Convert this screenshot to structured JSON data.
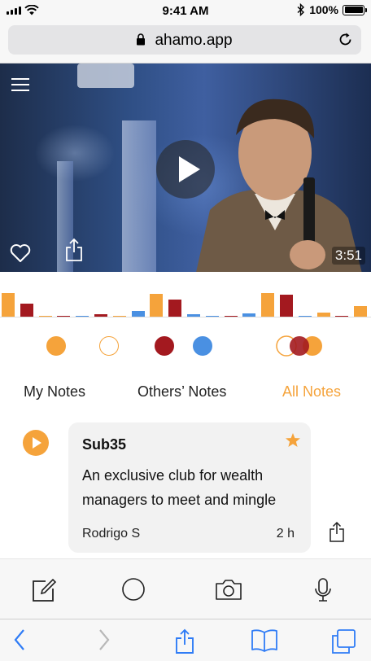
{
  "status_bar": {
    "time": "9:41 AM",
    "battery_percent": "100%",
    "icons": [
      "signal-icon",
      "wifi-icon",
      "bluetooth-icon",
      "battery-icon"
    ]
  },
  "browser": {
    "url": "ahamo.app",
    "icons": [
      "lock-icon",
      "reload-icon"
    ]
  },
  "video": {
    "duration": "3:51",
    "icons": [
      "menu-icon",
      "play-icon",
      "heart-icon",
      "share-icon"
    ]
  },
  "timeline": {
    "colors": {
      "orange": "#f5a33b",
      "red": "#a3191f",
      "blue": "#4a90e2"
    },
    "bars": [
      {
        "color": "orange",
        "level": 1.0
      },
      {
        "color": "red",
        "level": 0.55
      },
      {
        "color": "orange",
        "level": 0.05
      },
      {
        "color": "red",
        "level": 0.05
      },
      {
        "color": "blue",
        "level": 0.05
      },
      {
        "color": "red",
        "level": 0.12
      },
      {
        "color": "orange",
        "level": 0.05
      },
      {
        "color": "blue",
        "level": 0.25
      },
      {
        "color": "orange",
        "level": 0.95
      },
      {
        "color": "red",
        "level": 0.72
      },
      {
        "color": "blue",
        "level": 0.12
      },
      {
        "color": "blue",
        "level": 0.05
      },
      {
        "color": "red",
        "level": 0.05
      },
      {
        "color": "blue",
        "level": 0.18
      },
      {
        "color": "orange",
        "level": 1.0
      },
      {
        "color": "red",
        "level": 0.92
      },
      {
        "color": "blue",
        "level": 0.05
      },
      {
        "color": "orange",
        "level": 0.2
      },
      {
        "color": "red",
        "level": 0.05
      },
      {
        "color": "orange",
        "level": 0.45
      }
    ]
  },
  "filter_dots": [
    {
      "name": "orange-filled-dot",
      "fill": "#f5a33b",
      "stroke": "#f5a33b"
    },
    {
      "name": "orange-outline-dot",
      "fill": "#ffffff",
      "stroke": "#f5a33b"
    },
    {
      "name": "red-filled-dot",
      "fill": "#a3191f",
      "stroke": "#a3191f"
    },
    {
      "name": "blue-filled-dot",
      "fill": "#4a90e2",
      "stroke": "#4a90e2"
    }
  ],
  "tabs": {
    "my_notes": "My Notes",
    "others_notes": "Others’ Notes",
    "all_notes": "All Notes",
    "active": "all_notes",
    "accent_color": "#f5a33b"
  },
  "note": {
    "title": "Sub35",
    "text": "An exclusive club for wealth managers to meet and mingle",
    "author": "Rodrigo S",
    "time": "2 h",
    "starred": true,
    "icons": [
      "play-icon",
      "star-icon",
      "share-icon"
    ]
  },
  "action_toolbar": {
    "icons": [
      "compose-icon",
      "record-circle-icon",
      "camera-icon",
      "microphone-icon"
    ]
  },
  "safari_toolbar": {
    "icons": [
      "back-icon",
      "forward-icon",
      "share-icon",
      "bookmarks-icon",
      "tabs-icon"
    ]
  }
}
